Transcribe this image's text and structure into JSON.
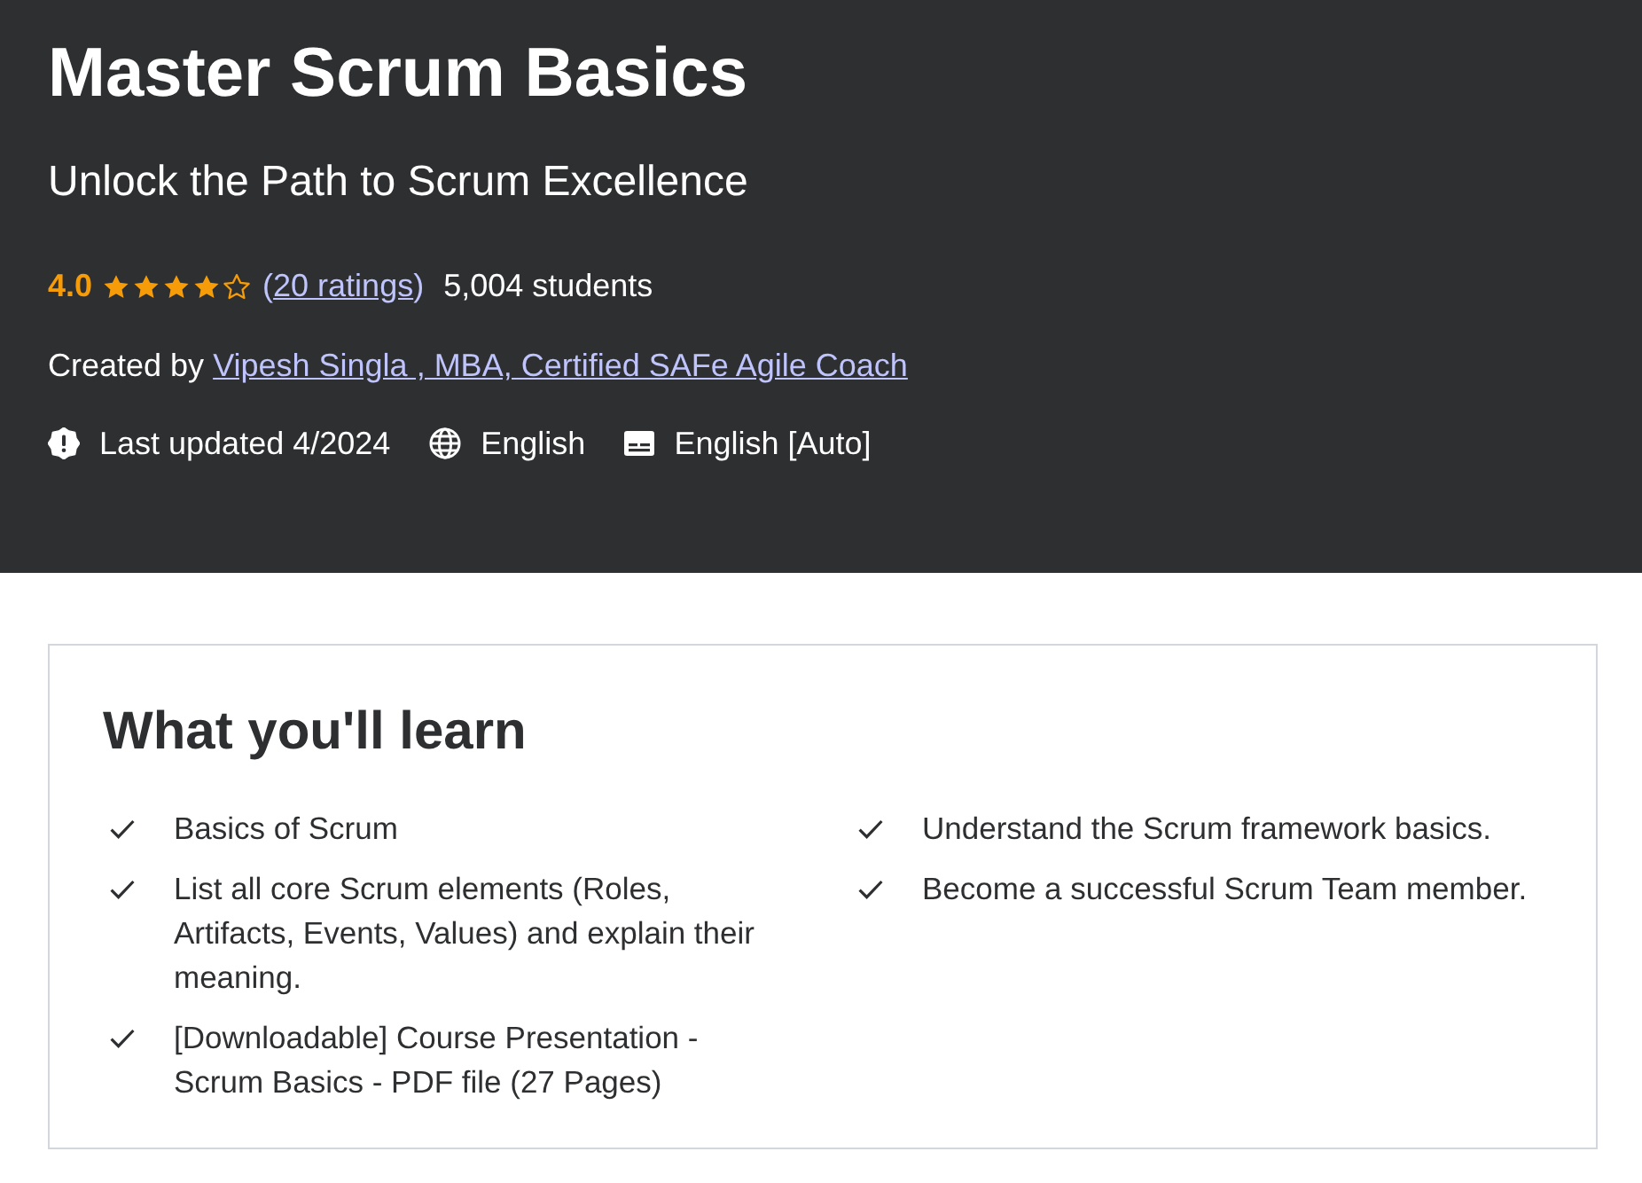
{
  "header": {
    "title": "Master Scrum Basics",
    "subtitle": "Unlock the Path to Scrum Excellence",
    "rating": {
      "score": "4.0",
      "stars": 4,
      "ratings_link": {
        "prefix": "(",
        "label": "20 ratings",
        "suffix": ")"
      },
      "students": "5,004 students"
    },
    "created_by": {
      "label": "Created by",
      "instructor": "Vipesh Singla , MBA, Certified SAFe Agile Coach"
    },
    "meta": [
      {
        "kind": "updated",
        "text": "Last updated 4/2024"
      },
      {
        "kind": "language",
        "text": "English"
      },
      {
        "kind": "captions",
        "text": "English [Auto]"
      }
    ]
  },
  "learn": {
    "heading": "What you'll learn",
    "columns": [
      {
        "items": [
          "Basics of Scrum",
          "List all core Scrum elements (Roles, Artifacts, Events, Values) and explain their meaning.",
          "[Downloadable] Course Presentation - Scrum Basics - PDF file (27 Pages)"
        ]
      },
      {
        "items": [
          "Understand the Scrum framework basics.",
          "Become a successful Scrum Team member."
        ]
      }
    ]
  }
}
